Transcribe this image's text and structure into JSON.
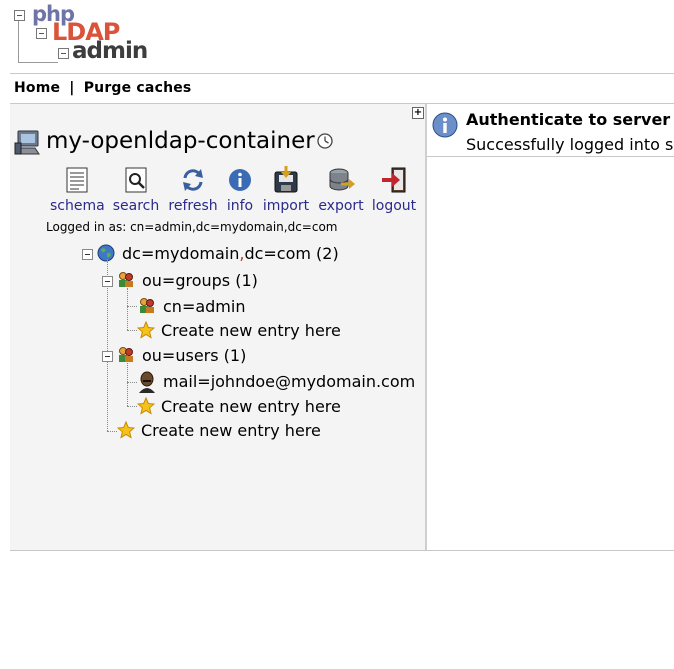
{
  "logo": {
    "line1": "php",
    "line2": "LDAP",
    "line3": "admin"
  },
  "topnav": {
    "home": "Home",
    "separator": "|",
    "purge": "Purge caches"
  },
  "server": {
    "name": "my-openldap-container"
  },
  "toolbar": [
    {
      "label": "schema",
      "icon": "schema-icon"
    },
    {
      "label": "search",
      "icon": "search-icon"
    },
    {
      "label": "refresh",
      "icon": "refresh-icon"
    },
    {
      "label": "info",
      "icon": "info-icon"
    },
    {
      "label": "import",
      "icon": "import-icon"
    },
    {
      "label": "export",
      "icon": "export-icon"
    },
    {
      "label": "logout",
      "icon": "logout-icon"
    }
  ],
  "logged_in": "Logged in as: cn=admin,dc=mydomain,dc=com",
  "tree": {
    "root": {
      "dn_part1": "dc=mydomain",
      "comma": ",",
      "dn_part2": "dc=com (2)"
    },
    "groups": {
      "label": "ou=groups (1)",
      "child": "cn=admin",
      "create": "Create new entry here"
    },
    "users": {
      "label": "ou=users (1)",
      "child": "mail=johndoe@mydomain.com",
      "create": "Create new entry here"
    },
    "root_create": "Create new entry here"
  },
  "message": {
    "title": "Authenticate to server",
    "body": "Successfully logged into server."
  },
  "colors": {
    "link": "#2a2a8c",
    "comma": "#c03030",
    "panel_bg": "#f4f4f4"
  }
}
